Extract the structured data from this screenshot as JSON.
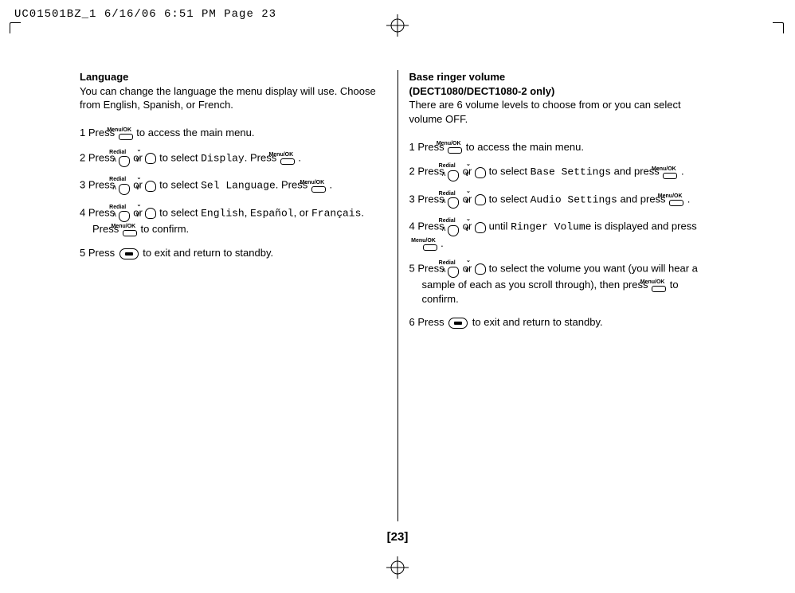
{
  "header": "UC01501BZ_1  6/16/06  6:51 PM  Page 23",
  "page_number": "[23]",
  "left": {
    "title": "Language",
    "intro": "You can change the language the menu display will use. Choose from English, Spanish, or French.",
    "s1a": "1  Press ",
    "s1b": " to access the main menu.",
    "s2a": "2  Press ",
    "or": " or ",
    "s2b": " to select ",
    "s2menu": "Display",
    "s2c": ". Press ",
    "period": " .",
    "s3a": "3  Press ",
    "s3menu": "Sel Language",
    "s4a": "4  Press ",
    "s4opt1": "English",
    "s4opt2": "Español",
    "or_word": ", or ",
    "s4opt3": "Français",
    "s4b": ". Press ",
    "s4c": " to confirm.",
    "s5a": "5  Press ",
    "s5b": "  to exit and return to standby."
  },
  "right": {
    "title1": "Base ringer volume",
    "title2": "(DECT1080/DECT1080-2 only)",
    "intro": "There are 6 volume levels to choose from or you can select volume OFF.",
    "s1a": "1  Press ",
    "s1b": " to access the main menu.",
    "s2a": "2  Press ",
    "or": " or ",
    "s2b": " to select ",
    "s2menu": "Base Settings",
    "andpress": " and press ",
    "period": " .",
    "s3a": "3  Press ",
    "s3menu": "Audio Settings",
    "s4a": "4  Press ",
    "s4b": " until ",
    "s4menu": "Ringer Volume",
    "s4c": " is displayed and press ",
    "s5a": "5  Press ",
    "s5b": " to select the volume you want (you will hear a sample of each as you scroll through), then press ",
    "s5c": " to confirm.",
    "s6a": "6  Press ",
    "s6b": "  to exit and return to standby."
  },
  "icons": {
    "menuok": "Menu/OK",
    "redial": "Redial"
  }
}
